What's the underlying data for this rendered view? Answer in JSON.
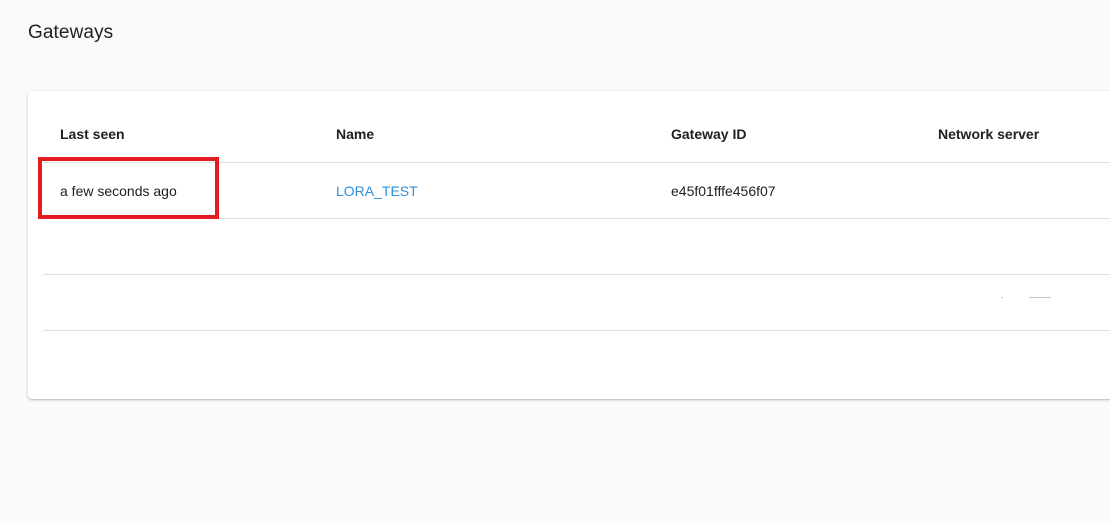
{
  "page": {
    "title": "Gateways"
  },
  "table": {
    "columns": {
      "last_seen": "Last seen",
      "name": "Name",
      "gateway_id": "Gateway ID",
      "network_server": "Network server"
    },
    "rows": [
      {
        "last_seen": "a few seconds ago",
        "name": "LORA_TEST",
        "gateway_id": "e45f01fffe456f07",
        "network_server": ""
      }
    ]
  },
  "colors": {
    "link": "#2f8fd8",
    "highlight": "#e21b23",
    "background": "#fafafa"
  }
}
